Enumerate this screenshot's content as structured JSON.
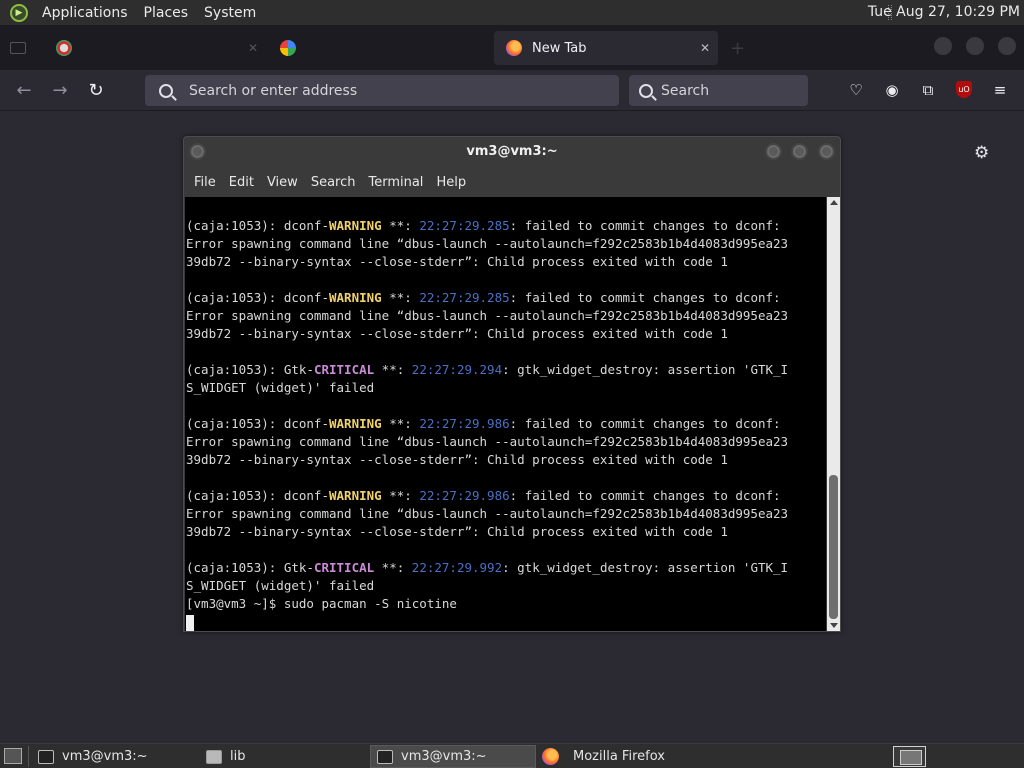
{
  "top_panel": {
    "menus": [
      "Applications",
      "Places",
      "System"
    ],
    "clock": "Tue Aug 27, 10:29 PM"
  },
  "browser": {
    "tabs": [
      {
        "label": "",
        "active": false
      },
      {
        "label": "",
        "active": false
      },
      {
        "label": "New Tab",
        "active": true
      }
    ],
    "url_placeholder": "Search or enter address",
    "search_placeholder": "Search"
  },
  "terminal": {
    "title": "vm3@vm3:~",
    "menu": [
      "File",
      "Edit",
      "View",
      "Search",
      "Terminal",
      "Help"
    ],
    "scroll_thumb_fraction": 0.35,
    "lines": [
      [
        {
          "t": "(caja:1053): dconf-"
        },
        {
          "t": "WARNING",
          "c": "warn"
        },
        {
          "t": " **: "
        },
        {
          "t": "22:27:29.285",
          "c": "ts"
        },
        {
          "t": ": failed to commit changes to dconf:"
        }
      ],
      [
        {
          "t": "Error spawning command line “dbus-launch --autolaunch=f292c2583b1b4d4083d995ea23"
        }
      ],
      [
        {
          "t": "39db72 --binary-syntax --close-stderr”: Child process exited with code 1"
        }
      ],
      [
        {
          "t": ""
        }
      ],
      [
        {
          "t": "(caja:1053): dconf-"
        },
        {
          "t": "WARNING",
          "c": "warn"
        },
        {
          "t": " **: "
        },
        {
          "t": "22:27:29.285",
          "c": "ts"
        },
        {
          "t": ": failed to commit changes to dconf:"
        }
      ],
      [
        {
          "t": "Error spawning command line “dbus-launch --autolaunch=f292c2583b1b4d4083d995ea23"
        }
      ],
      [
        {
          "t": "39db72 --binary-syntax --close-stderr”: Child process exited with code 1"
        }
      ],
      [
        {
          "t": ""
        }
      ],
      [
        {
          "t": "(caja:1053): Gtk-"
        },
        {
          "t": "CRITICAL",
          "c": "crit"
        },
        {
          "t": " **: "
        },
        {
          "t": "22:27:29.294",
          "c": "ts"
        },
        {
          "t": ": gtk_widget_destroy: assertion 'GTK_I"
        }
      ],
      [
        {
          "t": "S_WIDGET (widget)' failed"
        }
      ],
      [
        {
          "t": ""
        }
      ],
      [
        {
          "t": "(caja:1053): dconf-"
        },
        {
          "t": "WARNING",
          "c": "warn"
        },
        {
          "t": " **: "
        },
        {
          "t": "22:27:29.986",
          "c": "ts"
        },
        {
          "t": ": failed to commit changes to dconf:"
        }
      ],
      [
        {
          "t": "Error spawning command line “dbus-launch --autolaunch=f292c2583b1b4d4083d995ea23"
        }
      ],
      [
        {
          "t": "39db72 --binary-syntax --close-stderr”: Child process exited with code 1"
        }
      ],
      [
        {
          "t": ""
        }
      ],
      [
        {
          "t": "(caja:1053): dconf-"
        },
        {
          "t": "WARNING",
          "c": "warn"
        },
        {
          "t": " **: "
        },
        {
          "t": "22:27:29.986",
          "c": "ts"
        },
        {
          "t": ": failed to commit changes to dconf:"
        }
      ],
      [
        {
          "t": "Error spawning command line “dbus-launch --autolaunch=f292c2583b1b4d4083d995ea23"
        }
      ],
      [
        {
          "t": "39db72 --binary-syntax --close-stderr”: Child process exited with code 1"
        }
      ],
      [
        {
          "t": ""
        }
      ],
      [
        {
          "t": "(caja:1053): Gtk-"
        },
        {
          "t": "CRITICAL",
          "c": "crit"
        },
        {
          "t": " **: "
        },
        {
          "t": "22:27:29.992",
          "c": "ts"
        },
        {
          "t": ": gtk_widget_destroy: assertion 'GTK_I"
        }
      ],
      [
        {
          "t": "S_WIDGET (widget)' failed"
        }
      ],
      [
        {
          "t": "[vm3@vm3 ~]$ sudo pacman -S nicotine"
        }
      ]
    ]
  },
  "taskbar": {
    "items": [
      {
        "label": "vm3@vm3:~",
        "icon": "terminal-icon",
        "active": false
      },
      {
        "label": "lib",
        "icon": "folder-icon",
        "active": false
      },
      {
        "label": "vm3@vm3:~",
        "icon": "terminal-icon",
        "active": true
      },
      {
        "label": "Mozilla Firefox",
        "icon": "firefox-icon",
        "active": false
      }
    ]
  },
  "colors": {
    "warning": "#f1d26c",
    "critical": "#c98bd6",
    "timestamp": "#4a6fc4",
    "browser_bg": "#2b2a33"
  }
}
